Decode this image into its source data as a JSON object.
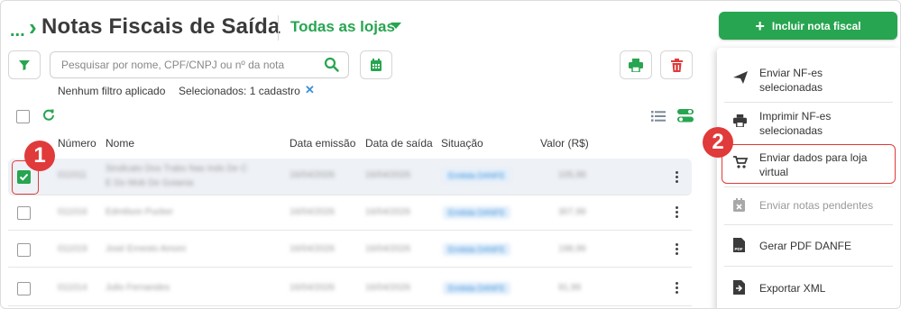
{
  "header": {
    "breadcrumb_dots": "...",
    "title": "Notas Fiscais de Saída",
    "store_filter": "Todas as lojas",
    "primary_button": "Incluir nota fiscal"
  },
  "toolbar": {
    "search_placeholder": "Pesquisar por nome, CPF/CNPJ ou nº da nota",
    "filter_status": "Nenhum filtro aplicado",
    "selection_status": "Selecionados: 1 cadastro",
    "clear_selection": "✕"
  },
  "table": {
    "columns": [
      "Número",
      "Nome",
      "Data emissão",
      "Data de saída",
      "Situação",
      "Valor (R$)"
    ],
    "rows": [
      {
        "number": "011011",
        "name_line1": "Sindicato Dos Trabs Nas Inds De C",
        "name_line2": "E Do Mob De Goiania",
        "emission": "16/04/2026",
        "exit": "16/04/2026",
        "status": "Emitida DANFE",
        "value": "105,99",
        "selected": true
      },
      {
        "number": "011016",
        "name_line1": "Edmilson Pucker",
        "name_line2": "",
        "emission": "16/04/2026",
        "exit": "16/04/2026",
        "status": "Emitida DANFE",
        "value": "307,99",
        "selected": false
      },
      {
        "number": "011019",
        "name_line1": "José Ernesto Amoni",
        "name_line2": "",
        "emission": "16/04/2026",
        "exit": "16/04/2026",
        "status": "Emitida DANFE",
        "value": "198,99",
        "selected": false
      },
      {
        "number": "011014",
        "name_line1": "Julio Fernandes",
        "name_line2": "",
        "emission": "16/04/2026",
        "exit": "16/04/2026",
        "status": "Emitida DANFE",
        "value": "91,99",
        "selected": false
      }
    ]
  },
  "menu": {
    "items": [
      {
        "label": "Enviar NF-es selecionadas",
        "icon": "send-icon",
        "disabled": false
      },
      {
        "label": "Imprimir NF-es selecionadas",
        "icon": "printer-icon",
        "disabled": false
      },
      {
        "label": "Enviar dados para loja virtual",
        "icon": "cart-icon",
        "disabled": false
      },
      {
        "label": "Enviar notas pendentes",
        "icon": "calendar-x-icon",
        "disabled": true
      },
      {
        "label": "Gerar PDF DANFE",
        "icon": "pdf-file-icon",
        "disabled": false
      },
      {
        "label": "Exportar XML",
        "icon": "export-file-icon",
        "disabled": false
      }
    ]
  },
  "callouts": [
    "1",
    "2"
  ],
  "colors": {
    "accent": "#27a550",
    "danger": "#e03a3a",
    "link": "#3a8fd8"
  }
}
